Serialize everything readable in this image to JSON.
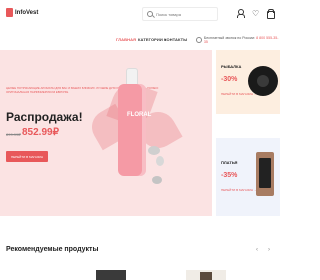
{
  "brand": {
    "name": "InfoVest",
    "accent": "#e8585a"
  },
  "header": {
    "search_placeholder": "Поиск товара",
    "icons": [
      "user-icon",
      "heart-icon",
      "cart-icon"
    ]
  },
  "nav": {
    "items": [
      "ГЛАВНАЯ",
      "КАТЕГОРИИ",
      "КОНТАКТЫ"
    ],
    "phone_label": "Бесплатный звонок по России:",
    "phone_number": "8 800 555-35-35"
  },
  "hero": {
    "description": "ЦЕЛЫЕ ПОТРЯСАЮЩИЕ АРОМАТЫ ДЛЯ ВАС И ВАШИХ БЛИЗКИХ. ЛУЧШИЕ ДУХИ ПО ЛУЧШИМ ЦЕНАМ. ТОЛЬКО ОРИГИНАЛЬНАЯ ПАРФЮМЕРИЯ ИЗ ЕВРОПЫ.",
    "title": "Распродажа!",
    "old_price": "899.99₽",
    "new_price": "852.99₽",
    "button_label": "ПЕРЕЙТИ В МАГАЗИН",
    "bottle_text": "FLORAL"
  },
  "promos": [
    {
      "title": "РЫБАЛКА",
      "discount": "-30%",
      "link": "ПЕРЕЙТИ В МАГАЗИН →"
    },
    {
      "title": "ПЛАТЬЯ",
      "discount": "-35%",
      "link": "ПЕРЕЙТИ В МАГАЗИН →"
    }
  ],
  "recommended": {
    "title": "Рекомендуемые продукты",
    "prev": "‹",
    "next": "›"
  }
}
